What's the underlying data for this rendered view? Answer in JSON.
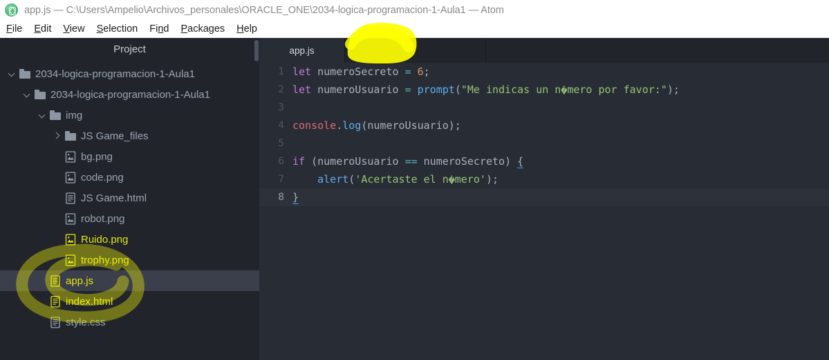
{
  "window": {
    "title": "app.js — C:\\Users\\Ampelio\\Archivos_personales\\ORACLE_ONE\\2034-logica-programacion-1-Aula1 — Atom",
    "app_icon": "atom-logo-icon"
  },
  "menubar": {
    "items": [
      {
        "label": "File",
        "mnemonic_index": 0
      },
      {
        "label": "Edit",
        "mnemonic_index": 0
      },
      {
        "label": "View",
        "mnemonic_index": 0
      },
      {
        "label": "Selection",
        "mnemonic_index": 0
      },
      {
        "label": "Find",
        "mnemonic_index": 2
      },
      {
        "label": "Packages",
        "mnemonic_index": 0
      },
      {
        "label": "Help",
        "mnemonic_index": 0
      }
    ]
  },
  "sidebar": {
    "title": "Project",
    "tree": [
      {
        "label": "2034-logica-programacion-1-Aula1",
        "kind": "folder",
        "twisty": "open",
        "depth": 0,
        "color": "#9da5b4",
        "selected": false
      },
      {
        "label": "2034-logica-programacion-1-Aula1",
        "kind": "folder",
        "twisty": "open",
        "depth": 1,
        "color": "#9da5b4",
        "selected": false
      },
      {
        "label": "img",
        "kind": "folder",
        "twisty": "open",
        "depth": 2,
        "color": "#9da5b4",
        "selected": false
      },
      {
        "label": "JS Game_files",
        "kind": "folder",
        "twisty": "closed",
        "depth": 3,
        "color": "#9da5b4",
        "selected": false
      },
      {
        "label": "bg.png",
        "kind": "image",
        "twisty": "none",
        "depth": 3,
        "color": "#9da5b4",
        "selected": false
      },
      {
        "label": "code.png",
        "kind": "image",
        "twisty": "none",
        "depth": 3,
        "color": "#9da5b4",
        "selected": false
      },
      {
        "label": "JS Game.html",
        "kind": "file",
        "twisty": "none",
        "depth": 3,
        "color": "#9da5b4",
        "selected": false
      },
      {
        "label": "robot.png",
        "kind": "image",
        "twisty": "none",
        "depth": 3,
        "color": "#9da5b4",
        "selected": false
      },
      {
        "label": "Ruido.png",
        "kind": "image",
        "twisty": "none",
        "depth": 3,
        "color": "#e5e510",
        "selected": false
      },
      {
        "label": "trophy.png",
        "kind": "image",
        "twisty": "none",
        "depth": 3,
        "color": "#e5e510",
        "selected": false
      },
      {
        "label": "app.js",
        "kind": "file",
        "twisty": "none",
        "depth": 2,
        "color": "#e5e510",
        "selected": true
      },
      {
        "label": "index.html",
        "kind": "file",
        "twisty": "none",
        "depth": 2,
        "color": "#e5e510",
        "selected": false
      },
      {
        "label": "style.css",
        "kind": "file",
        "twisty": "none",
        "depth": 2,
        "color": "#9da5b4",
        "selected": false
      }
    ]
  },
  "tabs": [
    {
      "label": "app.js",
      "active": true
    }
  ],
  "editor": {
    "filename": "app.js",
    "active_line": 8,
    "lines": [
      {
        "n": 1,
        "text": "let numeroSecreto = 6;"
      },
      {
        "n": 2,
        "text": "let numeroUsuario = prompt(\"Me indicas un n�mero por favor:\");"
      },
      {
        "n": 3,
        "text": ""
      },
      {
        "n": 4,
        "text": "console.log(numeroUsuario);"
      },
      {
        "n": 5,
        "text": ""
      },
      {
        "n": 6,
        "text": "if (numeroUsuario == numeroSecreto) {"
      },
      {
        "n": 7,
        "text": "    alert('Acertaste el n�mero');"
      },
      {
        "n": 8,
        "text": "}"
      }
    ]
  },
  "annotations": [
    {
      "name": "tab-highlight",
      "shape": "blob",
      "color": "#ffff00"
    },
    {
      "name": "sidebar-highlight",
      "shape": "circle",
      "color": "#ffff00"
    }
  ],
  "colors": {
    "titlebar_bg": "#ffffff",
    "sidebar_bg": "#21252b",
    "editor_bg": "#282c34",
    "tabbar_bg": "#21252b",
    "selection_bg": "#3a3f4b",
    "active_line_bg": "#2c313a",
    "highlight_yellow": "#ffff00",
    "git_modified": "#e5e510"
  }
}
